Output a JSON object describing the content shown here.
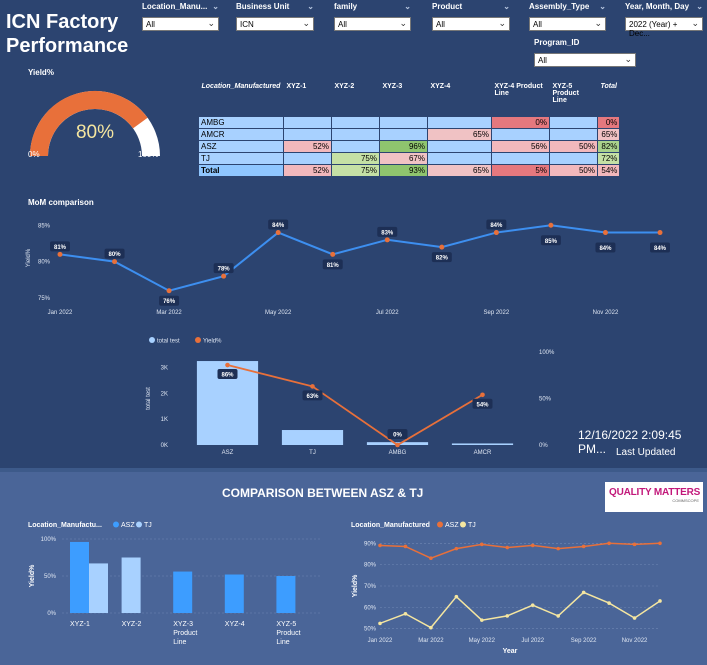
{
  "title": {
    "line1": "ICN Factory",
    "line2": "Performance"
  },
  "filters": [
    {
      "label": "Location_Manu...",
      "value": "All"
    },
    {
      "label": "Business Unit",
      "value": "ICN"
    },
    {
      "label": "family",
      "value": "All"
    },
    {
      "label": "Product",
      "value": "All"
    },
    {
      "label": "Assembly_Type",
      "value": "All"
    },
    {
      "label": "Year, Month, Day",
      "value": "2022 (Year) + Dec..."
    },
    {
      "label": "Program_ID",
      "value": "All"
    }
  ],
  "gauge": {
    "title": "Yield%",
    "value": 80,
    "value_label": "80%",
    "min_label": "0%",
    "max_label": "100%",
    "colors": {
      "fill": "#e8703a",
      "track": "#ffffff"
    }
  },
  "matrix": {
    "row_header": "Location_Manufactured",
    "columns": [
      "XYZ-1",
      "XYZ-2",
      "XYZ-3",
      "XYZ-4",
      "XYZ-4 Product Line",
      "XYZ-5 Product Line",
      "Total"
    ],
    "rows": [
      {
        "name": "AMBG",
        "cells": [
          "",
          "",
          "",
          "",
          "0%",
          "",
          "0%"
        ]
      },
      {
        "name": "AMCR",
        "cells": [
          "",
          "",
          "",
          "65%",
          "",
          "",
          "65%"
        ]
      },
      {
        "name": "ASZ",
        "cells": [
          "52%",
          "",
          "96%",
          "",
          "56%",
          "50%",
          "82%"
        ]
      },
      {
        "name": "TJ",
        "cells": [
          "",
          "75%",
          "67%",
          "",
          "",
          "",
          "72%"
        ]
      },
      {
        "name": "Total",
        "cells": [
          "52%",
          "75%",
          "93%",
          "65%",
          "5%",
          "50%",
          "54%"
        ]
      }
    ]
  },
  "chart_data": [
    {
      "id": "mom",
      "type": "line",
      "title": "MoM comparison",
      "ylabel": "Yield%",
      "x": [
        "Jan 2022",
        "Feb 2022",
        "Mar 2022",
        "Apr 2022",
        "May 2022",
        "Jun 2022",
        "Jul 2022",
        "Aug 2022",
        "Sep 2022",
        "Oct 2022",
        "Nov 2022",
        "Dec 2022"
      ],
      "x_tick_labels": [
        "Jan 2022",
        "Mar 2022",
        "May 2022",
        "Jul 2022",
        "Sep 2022",
        "Nov 2022"
      ],
      "values": [
        81,
        80,
        76,
        78,
        84,
        81,
        83,
        82,
        84,
        85,
        84,
        84
      ],
      "labels": [
        "81%",
        "80%",
        "76%",
        "78%",
        "84%",
        "81%",
        "83%",
        "82%",
        "84%",
        "85%",
        "84%",
        "84%"
      ],
      "y_ticks": [
        "75%",
        "80%",
        "85%"
      ],
      "ylim": [
        75,
        86
      ],
      "colors": {
        "line": "#3d8ff0",
        "marker": "#e8703a"
      }
    },
    {
      "id": "combo",
      "type": "bar",
      "categories": [
        "ASZ",
        "TJ",
        "AMBG",
        "AMCR"
      ],
      "series": [
        {
          "name": "total test",
          "type": "bar",
          "values": [
            3250,
            580,
            110,
            60
          ],
          "color": "#a8d1ff"
        },
        {
          "name": "Yield%",
          "type": "line",
          "axis": "right",
          "values": [
            86,
            63,
            0,
            54
          ],
          "labels": [
            "86%",
            "63%",
            "0%",
            "54%"
          ],
          "color": "#e8703a"
        }
      ],
      "ylabel": "total test",
      "y_ticks": [
        "0K",
        "1K",
        "2K",
        "3K"
      ],
      "ylim": [
        0,
        3600
      ],
      "y2_ticks": [
        "0%",
        "50%",
        "100%"
      ],
      "y2lim": [
        0,
        100
      ]
    },
    {
      "id": "bottom-bar",
      "type": "bar",
      "title": "Location_Manufactu...",
      "ylabel": "Yield%",
      "categories": [
        "XYZ-1",
        "XYZ-2",
        "XYZ-3 Product Line",
        "XYZ-4",
        "XYZ-5 Product Line"
      ],
      "series": [
        {
          "name": "ASZ",
          "values": [
            96,
            null,
            56,
            52,
            50
          ],
          "color": "#3d9dff"
        },
        {
          "name": "TJ",
          "values": [
            67,
            75,
            null,
            null,
            null
          ],
          "color": "#a8d1ff"
        }
      ],
      "y_ticks": [
        "0%",
        "50%",
        "100%"
      ],
      "ylim": [
        0,
        100
      ]
    },
    {
      "id": "bottom-line",
      "type": "line",
      "title": "Location_Manufactured",
      "xlabel": "Year",
      "ylabel": "Yield%",
      "x": [
        "Jan 2022",
        "Feb 2022",
        "Mar 2022",
        "Apr 2022",
        "May 2022",
        "Jun 2022",
        "Jul 2022",
        "Aug 2022",
        "Sep 2022",
        "Oct 2022",
        "Nov 2022",
        "Dec 2022"
      ],
      "x_tick_labels": [
        "Jan 2022",
        "Mar 2022",
        "May 2022",
        "Jul 2022",
        "Sep 2022",
        "Nov 2022"
      ],
      "series": [
        {
          "name": "ASZ",
          "values": [
            89,
            88.5,
            83,
            87.5,
            89.5,
            88,
            89,
            87.5,
            88.5,
            90,
            89.5,
            90
          ],
          "color": "#e8703a"
        },
        {
          "name": "TJ",
          "values": [
            52.5,
            57,
            50.5,
            65,
            54,
            56,
            61,
            56,
            67,
            62,
            55,
            63
          ],
          "color": "#f5e6a0"
        }
      ],
      "y_ticks": [
        "50%",
        "60%",
        "70%",
        "80%",
        "90%"
      ],
      "ylim": [
        48,
        92
      ]
    }
  ],
  "last_updated": {
    "timestamp": "12/16/2022 2:09:45 PM...",
    "label": "Last Updated"
  },
  "comparison_heading": "COMPARISON BETWEEN ASZ & TJ",
  "logo": {
    "text": "QUALITY MATTERS",
    "subtext": "COMMSCOPE"
  },
  "legend": {
    "combo": [
      "total test",
      "Yield%"
    ],
    "asz": "ASZ",
    "tj": "TJ"
  }
}
